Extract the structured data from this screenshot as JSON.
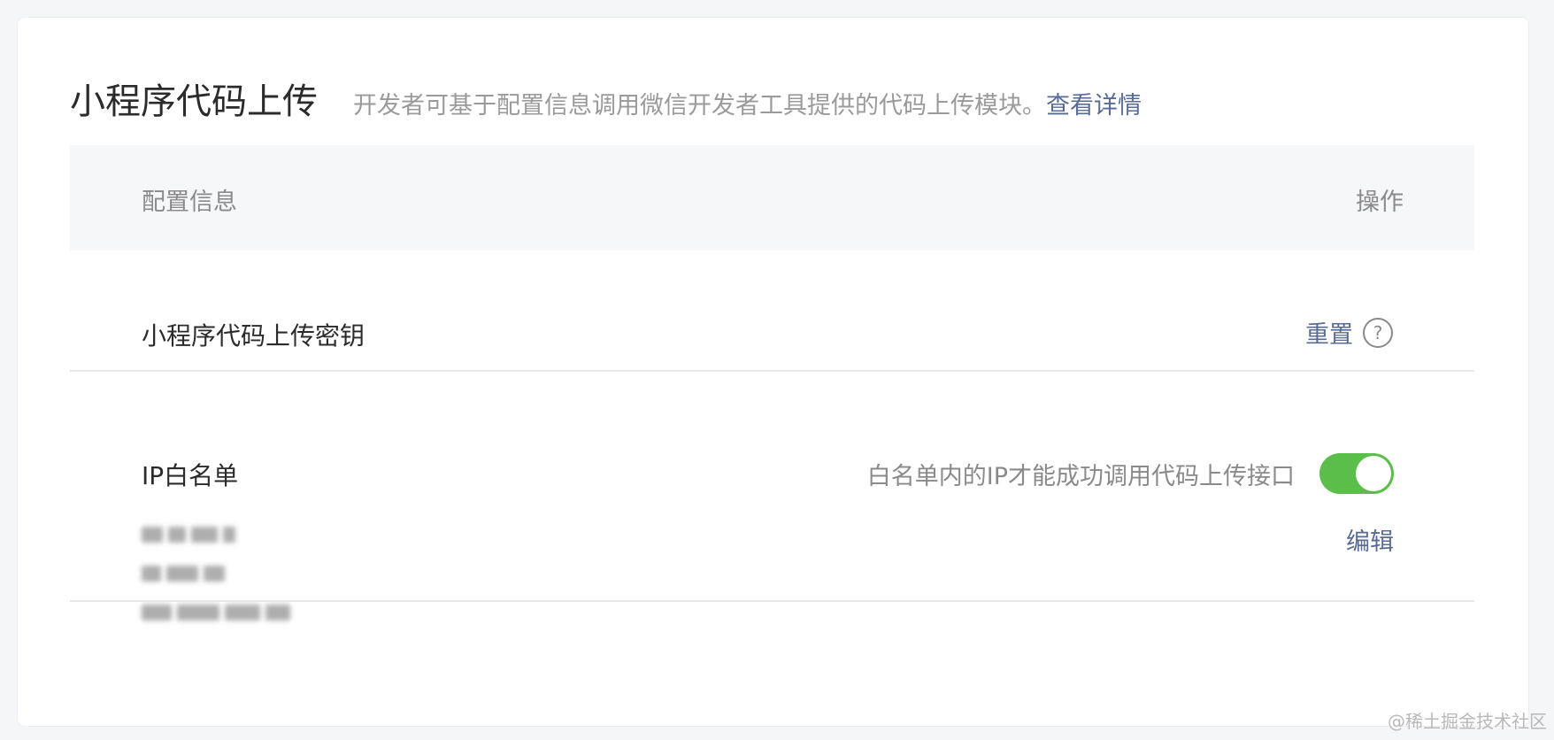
{
  "header": {
    "title": "小程序代码上传",
    "description": "开发者可基于配置信息调用微信开发者工具提供的代码上传模块。",
    "details_link": "查看详情"
  },
  "table": {
    "col_config": "配置信息",
    "col_action": "操作"
  },
  "upload_key_row": {
    "label": "小程序代码上传密钥",
    "reset_label": "重置",
    "help_icon": "question-circle-icon"
  },
  "ip_whitelist_row": {
    "label": "IP白名单",
    "hint": "白名单内的IP才能成功调用代码上传接口",
    "toggle_on": true,
    "edit_label": "编辑",
    "ip_entries_blurred_count_shown": [
      "",
      "",
      ""
    ]
  },
  "watermark": "@稀土掘金技术社区",
  "colors": {
    "link": "#576b95",
    "toggle_on": "#5bbd4a",
    "header_bg": "#f6f7f9"
  }
}
